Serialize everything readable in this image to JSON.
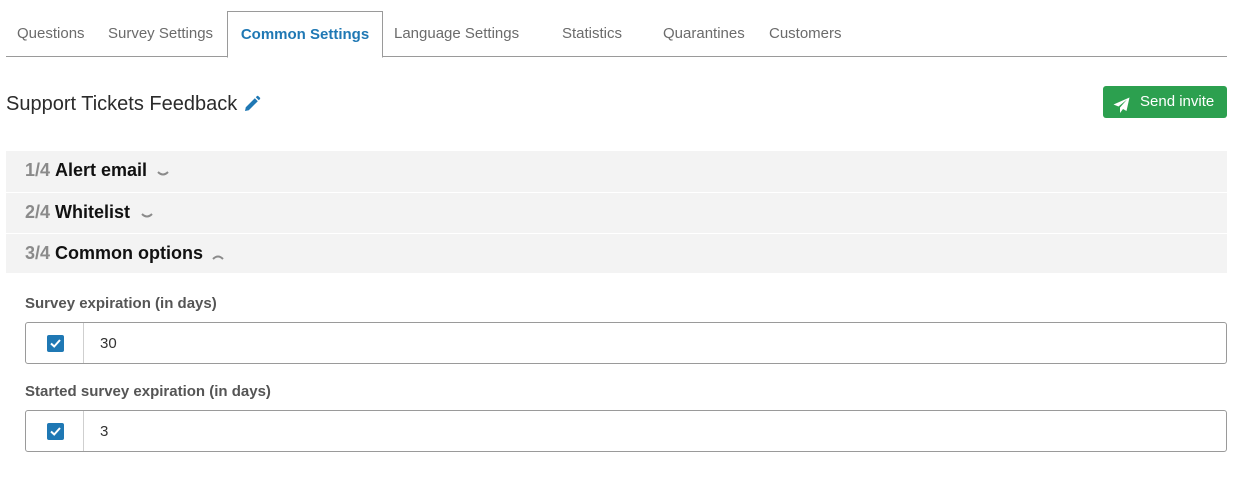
{
  "tabs": [
    {
      "label": "Questions",
      "active": false
    },
    {
      "label": "Survey Settings",
      "active": false
    },
    {
      "label": "Common Settings",
      "active": true
    },
    {
      "label": "Language Settings",
      "active": false
    },
    {
      "label": "Statistics",
      "active": false
    },
    {
      "label": "Quarantines",
      "active": false
    },
    {
      "label": "Customers",
      "active": false
    }
  ],
  "header": {
    "title": "Support Tickets Feedback",
    "edit_icon": "pencil-icon",
    "send_button": {
      "label": "Send invite",
      "icon": "paper-plane-icon",
      "color": "#2ca04f"
    }
  },
  "accordion": [
    {
      "number": "1/4",
      "label": "Alert email",
      "expanded": false
    },
    {
      "number": "2/4",
      "label": "Whitelist",
      "expanded": false
    },
    {
      "number": "3/4",
      "label": "Common options",
      "expanded": true
    }
  ],
  "fields": [
    {
      "label": "Survey expiration (in days)",
      "checked": true,
      "value": "30"
    },
    {
      "label": "Started survey expiration (in days)",
      "checked": true,
      "value": "3"
    }
  ],
  "colors": {
    "accent": "#1f78b4",
    "success": "#2ca04f"
  }
}
